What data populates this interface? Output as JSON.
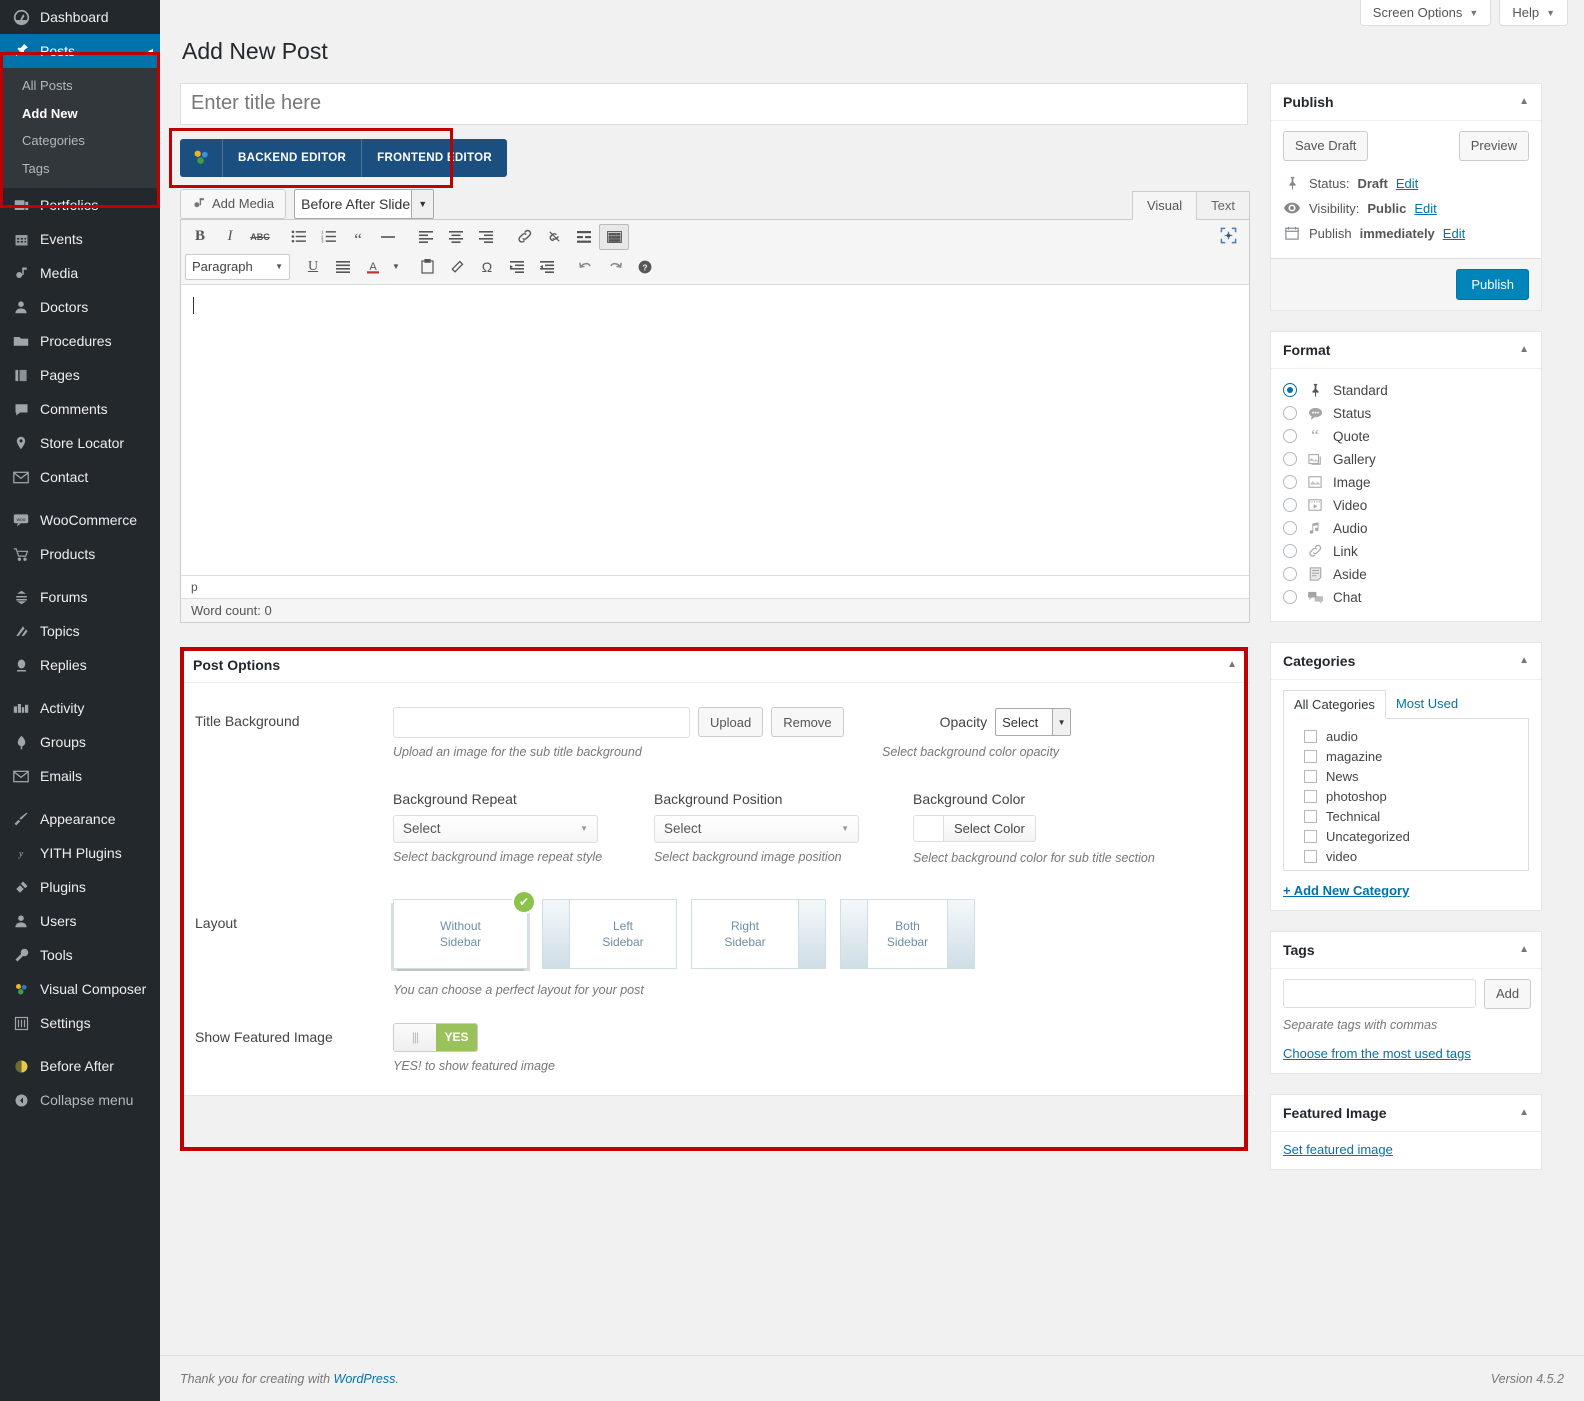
{
  "sidebar": {
    "items": [
      {
        "label": "Dashboard",
        "icon": "dashboard-icon"
      },
      {
        "label": "Posts",
        "icon": "pin-icon",
        "current": true
      },
      {
        "label": "Portfolios",
        "icon": "portfolio-icon"
      },
      {
        "label": "Events",
        "icon": "calendar-icon"
      },
      {
        "label": "Media",
        "icon": "media-icon"
      },
      {
        "label": "Doctors",
        "icon": "user-icon"
      },
      {
        "label": "Procedures",
        "icon": "folder-icon"
      },
      {
        "label": "Pages",
        "icon": "pages-icon"
      },
      {
        "label": "Comments",
        "icon": "comment-icon"
      },
      {
        "label": "Store Locator",
        "icon": "location-pin-icon"
      },
      {
        "label": "Contact",
        "icon": "envelope-icon"
      },
      {
        "label": "WooCommerce",
        "icon": "woocommerce-icon"
      },
      {
        "label": "Products",
        "icon": "cart-icon"
      },
      {
        "label": "Forums",
        "icon": "forums-icon"
      },
      {
        "label": "Topics",
        "icon": "topics-icon"
      },
      {
        "label": "Replies",
        "icon": "replies-icon"
      },
      {
        "label": "Activity",
        "icon": "activity-icon"
      },
      {
        "label": "Groups",
        "icon": "groups-icon"
      },
      {
        "label": "Emails",
        "icon": "envelope-icon"
      },
      {
        "label": "Appearance",
        "icon": "brush-icon"
      },
      {
        "label": "YITH Plugins",
        "icon": "yith-icon"
      },
      {
        "label": "Plugins",
        "icon": "plug-icon"
      },
      {
        "label": "Users",
        "icon": "users-icon"
      },
      {
        "label": "Tools",
        "icon": "wrench-icon"
      },
      {
        "label": "Visual Composer",
        "icon": "visual-composer-icon"
      },
      {
        "label": "Settings",
        "icon": "settings-sliders-icon"
      },
      {
        "label": "Before After",
        "icon": "before-after-icon"
      },
      {
        "label": "Collapse menu",
        "icon": "collapse-icon"
      }
    ],
    "posts_submenu": [
      {
        "label": "All Posts",
        "current": false
      },
      {
        "label": "Add New",
        "current": true
      },
      {
        "label": "Categories",
        "current": false
      },
      {
        "label": "Tags",
        "current": false
      }
    ]
  },
  "screen_meta": {
    "screen_options": "Screen Options",
    "help": "Help",
    "caret": "▼"
  },
  "page": {
    "title": "Add New Post",
    "title_placeholder": "Enter title here"
  },
  "vc": {
    "backend_editor": "BACKEND EDITOR",
    "frontend_editor": "FRONTEND EDITOR"
  },
  "editor": {
    "add_media": "Add Media",
    "shortcode_select": "Before After Slider",
    "tab_visual": "Visual",
    "tab_text": "Text",
    "format_select": "Paragraph",
    "path": "p",
    "word_count": "Word count: 0",
    "toolbar_row1": [
      {
        "name": "bold-icon",
        "glyph": "B"
      },
      {
        "name": "italic-icon",
        "glyph": "I"
      },
      {
        "name": "strikethrough-icon",
        "glyph": "ABC"
      },
      {
        "name": "bulleted-list-icon",
        "glyph": "☰"
      },
      {
        "name": "numbered-list-icon",
        "glyph": "☰"
      },
      {
        "name": "blockquote-icon",
        "glyph": "❝"
      },
      {
        "name": "horizontal-rule-icon",
        "glyph": "—"
      },
      {
        "name": "align-left-icon",
        "glyph": "≡"
      },
      {
        "name": "align-center-icon",
        "glyph": "≡"
      },
      {
        "name": "align-right-icon",
        "glyph": "≡"
      },
      {
        "name": "insert-link-icon",
        "glyph": "🔗"
      },
      {
        "name": "unlink-icon",
        "glyph": "⛓"
      },
      {
        "name": "read-more-icon",
        "glyph": "▤"
      },
      {
        "name": "toggle-toolbar-icon",
        "glyph": "▦"
      }
    ],
    "toolbar_row2": [
      {
        "name": "underline-icon",
        "glyph": "U"
      },
      {
        "name": "justify-icon",
        "glyph": "≣"
      },
      {
        "name": "text-color-icon",
        "glyph": "A"
      },
      {
        "name": "text-color-caret-icon",
        "glyph": "▾"
      },
      {
        "name": "paste-as-text-icon",
        "glyph": "📋"
      },
      {
        "name": "clear-formatting-icon",
        "glyph": "⌫"
      },
      {
        "name": "special-character-icon",
        "glyph": "Ω"
      },
      {
        "name": "outdent-icon",
        "glyph": "⇤"
      },
      {
        "name": "indent-icon",
        "glyph": "⇥"
      },
      {
        "name": "undo-icon",
        "glyph": "↶"
      },
      {
        "name": "redo-icon",
        "glyph": "↷"
      },
      {
        "name": "keyboard-shortcuts-icon",
        "glyph": "?"
      }
    ],
    "fullscreen_icon": "distraction-free-icon"
  },
  "post_options": {
    "box_title": "Post Options",
    "title_background": {
      "label": "Title Background",
      "value": "",
      "upload": "Upload",
      "remove": "Remove",
      "desc": "Upload an image for the sub title background"
    },
    "opacity": {
      "label": "Opacity",
      "value": "Select",
      "desc": "Select background color opacity"
    },
    "background_repeat": {
      "label": "Background Repeat",
      "value": "Select",
      "desc": "Select background image repeat style"
    },
    "background_position": {
      "label": "Background Position",
      "value": "Select",
      "desc": "Select background image position"
    },
    "background_color": {
      "label": "Background Color",
      "value": "Select Color",
      "desc": "Select background color for sub title section"
    },
    "layout": {
      "label": "Layout",
      "desc": "You can choose a perfect layout for your post",
      "options": [
        {
          "line1": "Without",
          "line2": "Sidebar",
          "type": "none",
          "selected": true
        },
        {
          "line1": "Left",
          "line2": "Sidebar",
          "type": "left",
          "selected": false
        },
        {
          "line1": "Right",
          "line2": "Sidebar",
          "type": "right",
          "selected": false
        },
        {
          "line1": "Both",
          "line2": "Sidebar",
          "type": "both",
          "selected": false
        }
      ]
    },
    "show_featured_image": {
      "label": "Show Featured Image",
      "state": "YES",
      "desc": "YES! to show featured image"
    }
  },
  "publish": {
    "title": "Publish",
    "save_draft": "Save Draft",
    "preview": "Preview",
    "status_label": "Status:",
    "status_value": "Draft",
    "status_edit": "Edit",
    "visibility_label": "Visibility:",
    "visibility_value": "Public",
    "visibility_edit": "Edit",
    "publish_label": "Publish",
    "publish_value": "immediately",
    "publish_edit": "Edit",
    "publish_button": "Publish"
  },
  "format": {
    "title": "Format",
    "options": [
      {
        "label": "Standard",
        "icon": "pin-icon",
        "selected": true
      },
      {
        "label": "Status",
        "icon": "status-bubble-icon",
        "selected": false
      },
      {
        "label": "Quote",
        "icon": "quote-icon",
        "selected": false
      },
      {
        "label": "Gallery",
        "icon": "gallery-icon",
        "selected": false
      },
      {
        "label": "Image",
        "icon": "image-icon",
        "selected": false
      },
      {
        "label": "Video",
        "icon": "video-icon",
        "selected": false
      },
      {
        "label": "Audio",
        "icon": "audio-icon",
        "selected": false
      },
      {
        "label": "Link",
        "icon": "link-icon",
        "selected": false
      },
      {
        "label": "Aside",
        "icon": "aside-icon",
        "selected": false
      },
      {
        "label": "Chat",
        "icon": "chat-icon",
        "selected": false
      }
    ]
  },
  "categories": {
    "title": "Categories",
    "tab_all": "All Categories",
    "tab_most_used": "Most Used",
    "items": [
      "audio",
      "magazine",
      "News",
      "photoshop",
      "Technical",
      "Uncategorized",
      "video"
    ],
    "add_new": "+ Add New Category"
  },
  "tags": {
    "title": "Tags",
    "value": "",
    "add_button": "Add",
    "desc": "Separate tags with commas",
    "most_used_link": "Choose from the most used tags"
  },
  "featured_image": {
    "title": "Featured Image",
    "set_link": "Set featured image"
  },
  "footer": {
    "thanks_prefix": "Thank you for creating with ",
    "wordpress": "WordPress",
    "thanks_suffix": ".",
    "version": "Version 4.5.2"
  },
  "colors": {
    "admin_blue": "#0073aa",
    "sidebar_bg": "#23282d",
    "highlight_red": "#c00000",
    "vc_blue": "#1b4f80",
    "toggle_green": "#9ac25b"
  }
}
